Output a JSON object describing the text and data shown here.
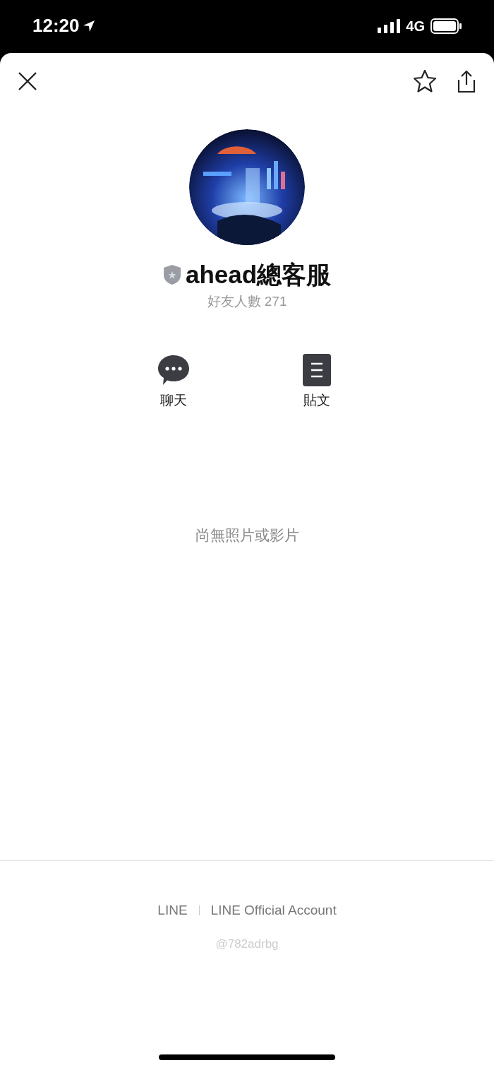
{
  "status_bar": {
    "time": "12:20",
    "network": "4G"
  },
  "profile": {
    "name": "ahead總客服",
    "friends": "好友人數 271"
  },
  "actions": [
    {
      "kind": "chat",
      "label": "聊天"
    },
    {
      "kind": "posts",
      "label": "貼文"
    }
  ],
  "empty_message": "尚無照片或影片",
  "footer": {
    "links": [
      "LINE",
      "LINE Official Account"
    ],
    "id": "@782adrbg"
  }
}
